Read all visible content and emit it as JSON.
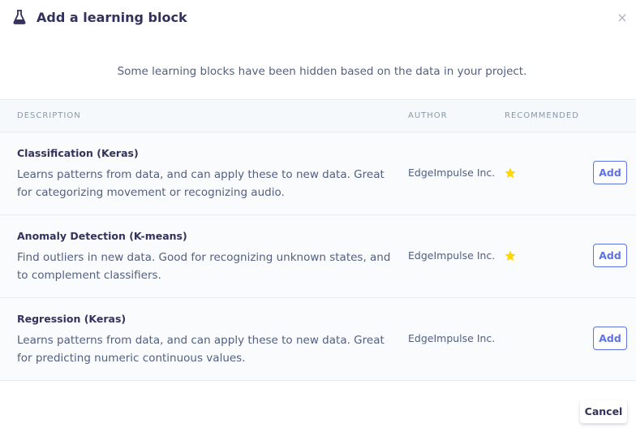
{
  "modal": {
    "title": "Add a learning block",
    "title_icon": "flask-icon",
    "close_icon": "close-icon",
    "close_glyph": "×"
  },
  "notice": "Some learning blocks have been hidden based on the data in your project.",
  "table": {
    "headers": {
      "description": "DESCRIPTION",
      "author": "AUTHOR",
      "recommended": "RECOMMENDED"
    },
    "rows": [
      {
        "title": "Classification (Keras)",
        "description": "Learns patterns from data, and can apply these to new data. Great for categorizing movement or recognizing audio.",
        "author": "EdgeImpulse Inc.",
        "recommended": true,
        "add_label": "Add"
      },
      {
        "title": "Anomaly Detection (K-means)",
        "description": "Find outliers in new data. Good for recognizing unknown states, and to complement classifiers.",
        "author": "EdgeImpulse Inc.",
        "recommended": true,
        "add_label": "Add"
      },
      {
        "title": "Regression (Keras)",
        "description": "Learns patterns from data, and can apply these to new data. Great for predicting numeric continuous values.",
        "author": "EdgeImpulse Inc.",
        "recommended": false,
        "add_label": "Add"
      }
    ]
  },
  "footer": {
    "cancel_label": "Cancel"
  },
  "colors": {
    "accent": "#5e72e4",
    "star": "#ffd600",
    "text": "#32325d",
    "header_bg": "#f6f9fc"
  }
}
